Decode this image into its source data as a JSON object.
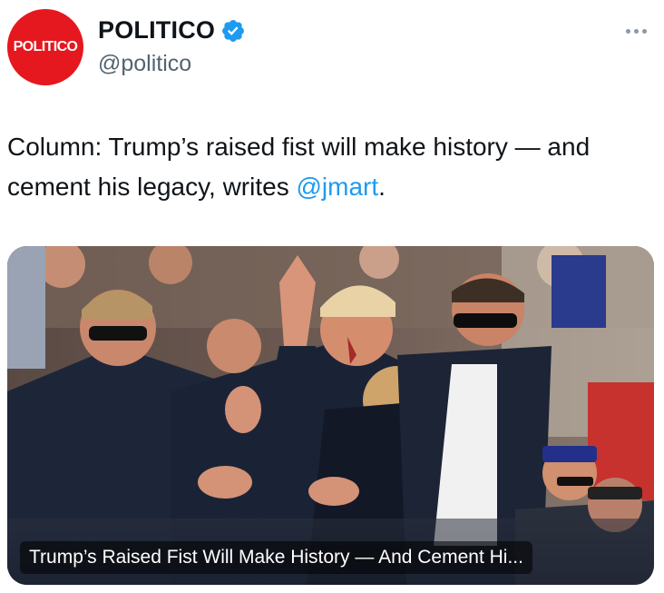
{
  "account": {
    "avatar_text": "POLITICO",
    "avatar_color": "#e5171f",
    "display_name": "POLITICO",
    "handle": "@politico",
    "verified_icon": "verified-badge-icon",
    "verified_color": "#1d9bf0"
  },
  "menu": {
    "icon": "more-options-icon"
  },
  "tweet": {
    "text_before": "Column: Trump’s raised fist will make history — and cement his legacy, writes ",
    "mention": "@jmart",
    "text_after": ".",
    "mention_color": "#1d9bf0"
  },
  "link_card": {
    "caption": "Trump’s Raised Fist Will Make History — And Cement Hi..."
  }
}
